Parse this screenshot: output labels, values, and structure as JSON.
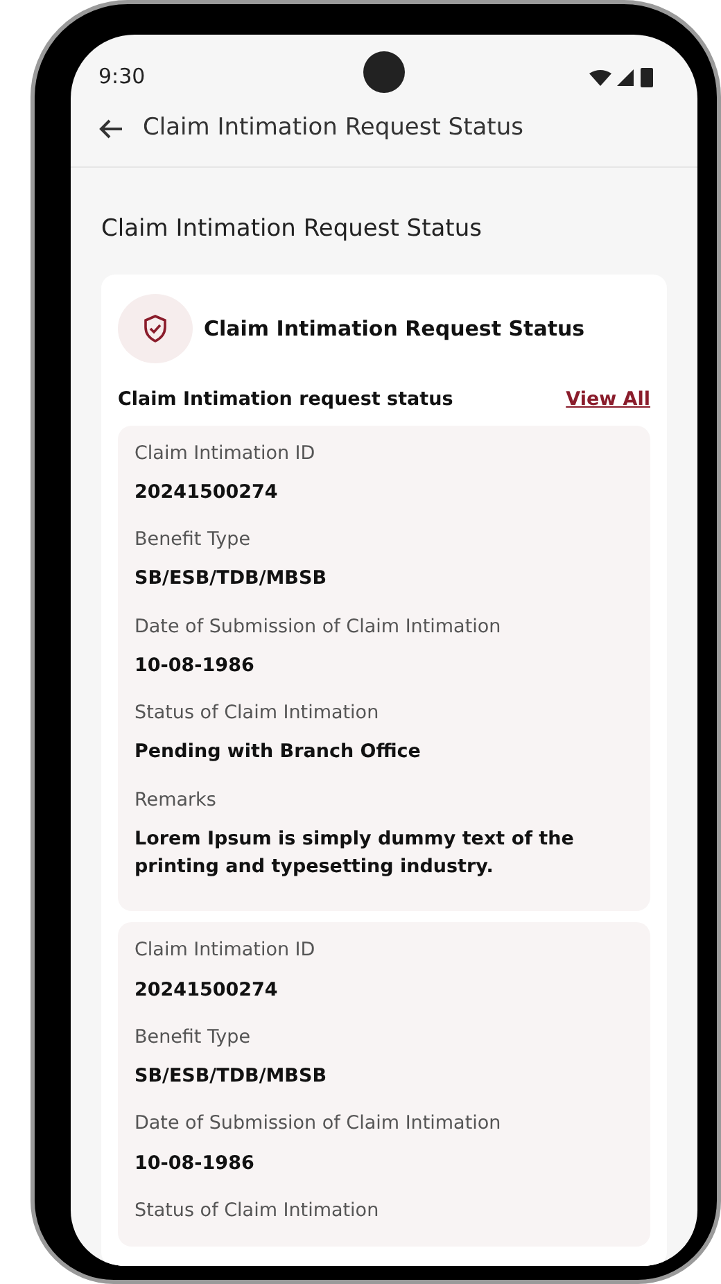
{
  "status_bar": {
    "time": "9:30"
  },
  "app_bar": {
    "title": "Claim Intimation Request Status"
  },
  "page_title": "Claim Intimation Request Status",
  "card": {
    "title": "Claim Intimation Request Status",
    "section_title": "Claim Intimation request status",
    "view_all": "View All",
    "requests": [
      {
        "fields": [
          {
            "label": "Claim Intimation ID",
            "value": "20241500274"
          },
          {
            "label": "Benefit Type",
            "value": "SB/ESB/TDB/MBSB"
          },
          {
            "label": "Date of Submission of Claim Intimation",
            "value": "10-08-1986"
          },
          {
            "label": "Status of Claim Intimation",
            "value": "Pending with Branch Office"
          },
          {
            "label": "Remarks",
            "value": "Lorem Ipsum is simply dummy text of the printing and typesetting industry."
          }
        ]
      },
      {
        "fields": [
          {
            "label": "Claim Intimation ID",
            "value": "20241500274"
          },
          {
            "label": "Benefit Type",
            "value": "SB/ESB/TDB/MBSB"
          },
          {
            "label": "Date of Submission of Claim Intimation",
            "value": "10-08-1986"
          },
          {
            "label": "Status of Claim Intimation"
          }
        ]
      }
    ]
  }
}
